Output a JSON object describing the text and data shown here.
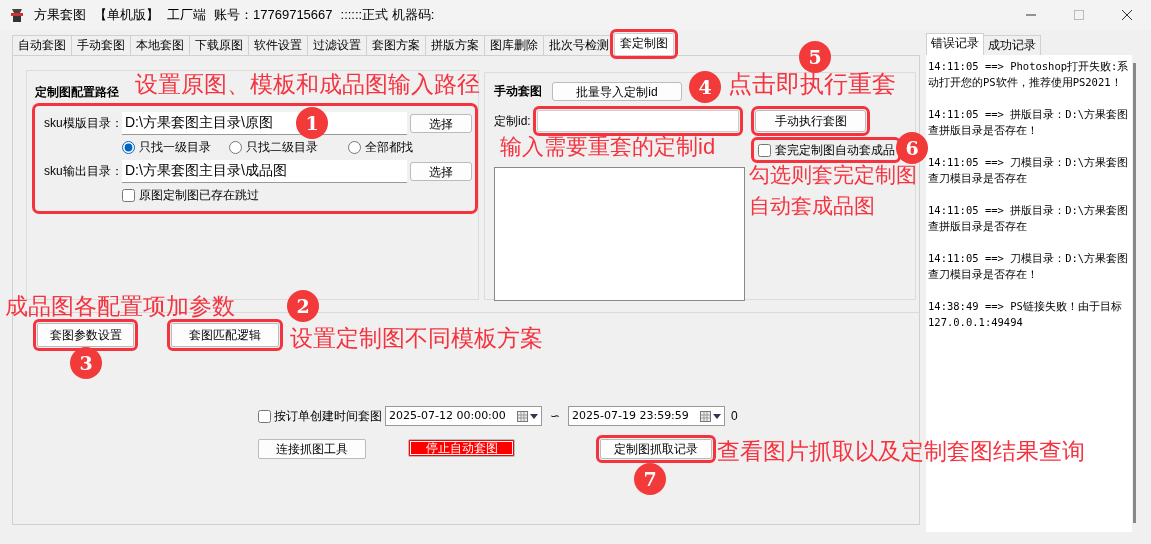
{
  "window": {
    "title": "方果套图",
    "edition": "【单机版】",
    "role": "工厂端",
    "account": "账号：17769715667",
    "license": "::::::正式 机器码:"
  },
  "tabs": [
    {
      "label": "自动套图",
      "selected": false,
      "highlighted": false
    },
    {
      "label": "手动套图",
      "selected": false,
      "highlighted": false
    },
    {
      "label": "本地套图",
      "selected": false,
      "highlighted": false
    },
    {
      "label": "下载原图",
      "selected": false,
      "highlighted": false
    },
    {
      "label": "软件设置",
      "selected": false,
      "highlighted": false
    },
    {
      "label": "过滤设置",
      "selected": false,
      "highlighted": false
    },
    {
      "label": "套图方案",
      "selected": false,
      "highlighted": false
    },
    {
      "label": "拼版方案",
      "selected": false,
      "highlighted": false
    },
    {
      "label": "图库删除",
      "selected": false,
      "highlighted": false
    },
    {
      "label": "批次号检测",
      "selected": false,
      "highlighted": false
    },
    {
      "label": "套定制图",
      "selected": true,
      "highlighted": true
    }
  ],
  "path_group": {
    "title": "定制图配置路径",
    "highlighted": true,
    "template_dir": {
      "label": "sku模版目录：",
      "value": "D:\\方果套图主目录\\原图",
      "button": "选择"
    },
    "search_scope": [
      {
        "label": "只找一级目录",
        "selected": true
      },
      {
        "label": "只找二级目录",
        "selected": false
      },
      {
        "label": "全部都找",
        "selected": false
      }
    ],
    "output_dir": {
      "label": "sku输出目录：",
      "value": "D:\\方果套图主目录\\成品图",
      "button": "选择"
    },
    "skip_existing": {
      "label": "原图定制图已存在跳过",
      "checked": false
    }
  },
  "manual_group": {
    "title": "手动套图",
    "import_button": "批量导入定制id",
    "id_field": {
      "label": "定制id:",
      "highlighted": true
    },
    "run_button": {
      "label": "手动执行套图",
      "highlighted": true
    },
    "auto_finish": {
      "label": "套完定制图自动套成品",
      "checked": false,
      "highlighted": true
    }
  },
  "setting_buttons": [
    {
      "label": "套图参数设置",
      "highlighted": true
    },
    {
      "label": "套图匹配逻辑",
      "highlighted": true
    }
  ],
  "time_filter": {
    "label": "按订单创建时间套图",
    "checked": false,
    "start": "2025-07-12 00:00:00",
    "separator": "∽",
    "end": "2025-07-19 23:59:59",
    "count": "0"
  },
  "action_buttons": [
    {
      "label": "连接抓图工具",
      "kind": "normal",
      "highlighted": false
    },
    {
      "label": "停止自动套图",
      "kind": "danger",
      "highlighted": false
    },
    {
      "label": "定制图抓取记录",
      "kind": "normal",
      "highlighted": true
    }
  ],
  "log_tabs": [
    {
      "label": "错误记录",
      "selected": true
    },
    {
      "label": "成功记录",
      "selected": false
    }
  ],
  "log_entries": [
    {
      "lines": [
        "14:11:05 ==> Photoshop打开失败:系",
        "动打开您的PS软件，推荐使用PS2021！"
      ]
    },
    {
      "lines": [
        "14:11:05 ==> 拼版目录：D:\\方果套图",
        "查拼版目录是否存在！"
      ]
    },
    {
      "lines": [
        "14:11:05 ==> 刀模目录：D:\\方果套图",
        "查刀模目录是否存在"
      ]
    },
    {
      "lines": [
        "14:11:05 ==> 拼版目录：D:\\方果套图",
        "查拼版目录是否存在"
      ]
    },
    {
      "lines": [
        "14:11:05 ==> 刀模目录：D:\\方果套图",
        "查刀模目录是否存在！"
      ]
    },
    {
      "lines": [
        "14:38:49 ==> PS链接失败！由于目标",
        "127.0.0.1:49494"
      ]
    }
  ],
  "callouts": [
    "设置原图、模板和成品图输入路径",
    "点击即执行重套",
    "输入需要重套的定制id",
    "勾选则套完定制图",
    "自动套成品图",
    "成品图各配置项加参数",
    "设置定制图不同模板方案",
    "查看图片抓取以及定制套图结果查询"
  ],
  "markers": [
    "1",
    "2",
    "3",
    "4",
    "5",
    "6",
    "7"
  ]
}
